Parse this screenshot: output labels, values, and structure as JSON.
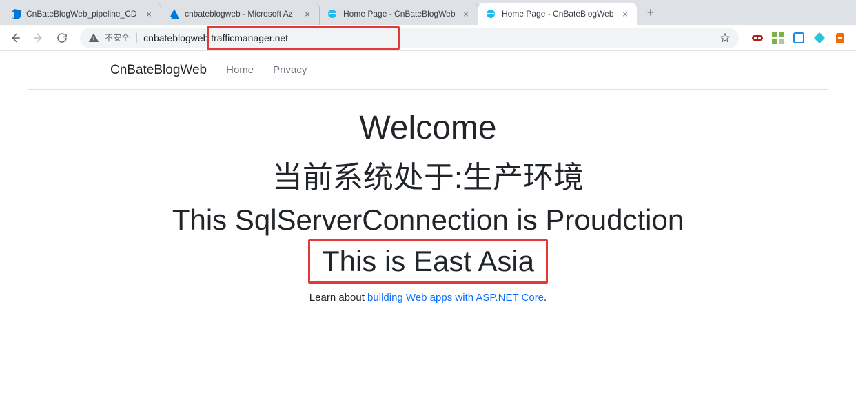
{
  "tabs": [
    {
      "title": "CnBateBlogWeb_pipeline_CD",
      "active": false,
      "favicon": "azdo"
    },
    {
      "title": "cnbateblogweb - Microsoft Az",
      "active": false,
      "favicon": "azure"
    },
    {
      "title": "Home Page - CnBateBlogWeb",
      "active": false,
      "favicon": "ie"
    },
    {
      "title": "Home Page - CnBateBlogWeb",
      "active": true,
      "favicon": "ie"
    }
  ],
  "toolbar": {
    "insecure_label": "不安全",
    "url": "cnbateblogweb.trafficmanager.net"
  },
  "siteNav": {
    "brand": "CnBateBlogWeb",
    "links": [
      "Home",
      "Privacy"
    ]
  },
  "hero": {
    "h1": "Welcome",
    "h2": "当前系统处于:生产环境",
    "h3": "This SqlServerConnection is Proudction",
    "h4": "This is East Asia",
    "learn_prefix": "Learn about ",
    "learn_link": "building Web apps with ASP.NET Core",
    "learn_suffix": "."
  },
  "colors": {
    "highlight": "#e53935",
    "link": "#0d6efd"
  }
}
